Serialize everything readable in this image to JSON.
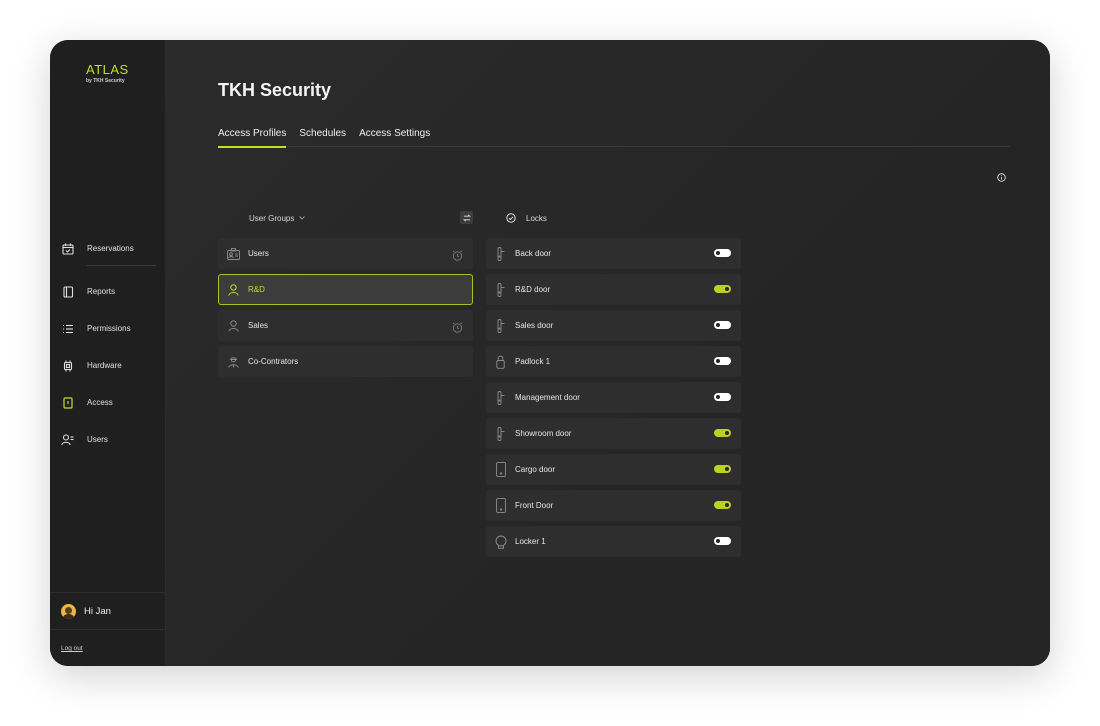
{
  "brand": {
    "name": "ATLAS",
    "subtitle": "by TKH Security"
  },
  "nav": [
    {
      "id": "reservations",
      "label": "Reservations",
      "icon": "calendar-icon"
    },
    {
      "id": "reports",
      "label": "Reports",
      "icon": "notebook-icon"
    },
    {
      "id": "permissions",
      "label": "Permissions",
      "icon": "list-icon"
    },
    {
      "id": "hardware",
      "label": "Hardware",
      "icon": "chip-icon"
    },
    {
      "id": "access",
      "label": "Access",
      "icon": "access-door-icon",
      "active": true
    },
    {
      "id": "users",
      "label": "Users",
      "icon": "users-icon"
    }
  ],
  "user": {
    "greeting": "Hi Jan",
    "logout_label": "Log out"
  },
  "page": {
    "title": "TKH Security"
  },
  "tabs": [
    {
      "label": "Access Profiles",
      "active": true
    },
    {
      "label": "Schedules"
    },
    {
      "label": "Access Settings"
    }
  ],
  "groups": {
    "header_label": "User Groups",
    "items": [
      {
        "label": "Users",
        "icon": "id-card-icon",
        "has_schedule": true
      },
      {
        "label": "R&D",
        "icon": "person-icon",
        "selected": true
      },
      {
        "label": "Sales",
        "icon": "person-icon",
        "has_schedule": true
      },
      {
        "label": "Co-Contrators",
        "icon": "worker-icon"
      }
    ]
  },
  "locks": {
    "header_label": "Locks",
    "items": [
      {
        "label": "Back door",
        "icon": "door-handle-icon",
        "enabled": false
      },
      {
        "label": "R&D door",
        "icon": "door-handle-icon",
        "enabled": true
      },
      {
        "label": "Sales door",
        "icon": "door-handle-icon",
        "enabled": false
      },
      {
        "label": "Padlock 1",
        "icon": "padlock-icon",
        "enabled": false
      },
      {
        "label": "Management door",
        "icon": "door-handle-icon",
        "enabled": false
      },
      {
        "label": "Showroom door",
        "icon": "door-handle-icon",
        "enabled": true
      },
      {
        "label": "Cargo door",
        "icon": "door-panel-icon",
        "enabled": true
      },
      {
        "label": "Front Door",
        "icon": "door-panel-icon",
        "enabled": true
      },
      {
        "label": "Locker 1",
        "icon": "locker-icon",
        "enabled": false
      }
    ]
  },
  "colors": {
    "accent": "#c6dc2b",
    "background": "#262626",
    "sidebar": "#1f1f1f",
    "row": "#2e2e2e"
  }
}
